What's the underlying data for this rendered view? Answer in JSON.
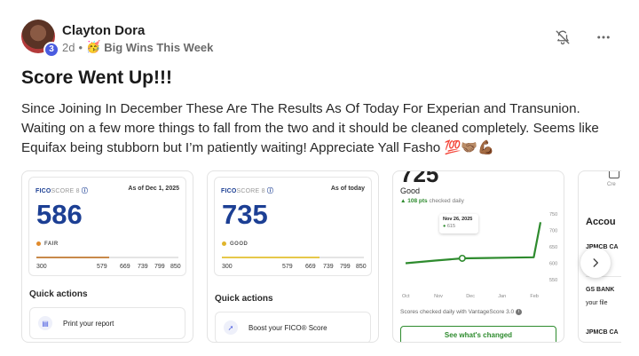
{
  "post": {
    "author": "Clayton Dora",
    "avatar_badge": "3",
    "time": "2d",
    "separator": "•",
    "group_emoji": "🥳",
    "group": "Big Wins This Week",
    "title": "Score Went Up!!!",
    "body": "Since Joining In December These Are The Results As Of Today For Experian and Transunion. Waiting on a few more things to fall from the two and it should be cleaned completely. Seems like Equifax being stubborn but I’m patiently waiting! Appreciate Yall Fasho 💯🤝🏽💪🏾"
  },
  "icons": {
    "notify": "bell-off-icon",
    "more": "more-horizontal-icon",
    "next": "chevron-right-icon"
  },
  "gallery": {
    "card1": {
      "logo_bold": "FICO",
      "logo_light": "SCORE 8",
      "date": "As of Dec 1, 2025",
      "score": "586",
      "rating": "FAIR",
      "rating_color": "#e08a2c",
      "fill_color": "#c8894a",
      "fill_fraction": 0.51,
      "scale": [
        "300",
        "579",
        "669",
        "739",
        "799",
        "850"
      ],
      "quick_title": "Quick actions",
      "action_label": "Print your report"
    },
    "card2": {
      "logo_bold": "FICO",
      "logo_light": "SCORE 8",
      "date": "As of today",
      "score": "735",
      "rating": "GOOD",
      "rating_color": "#e0b52c",
      "fill_color": "#e6c84a",
      "fill_fraction": 0.69,
      "scale": [
        "300",
        "579",
        "669",
        "739",
        "799",
        "850"
      ],
      "quick_title": "Quick actions",
      "action_label": "Boost your FICO® Score"
    },
    "card3": {
      "score": "725",
      "rating": "Good",
      "change": "▲ 108 pts",
      "change_note": "checked daily",
      "tooltip_date": "Nov 26, 2025",
      "tooltip_value": "615",
      "line_color": "#2e8b2e",
      "chart_data": {
        "type": "line",
        "x": [
          "Oct",
          "Nov",
          "Dec",
          "Jan",
          "Feb"
        ],
        "y_ticks": [
          "550",
          "600",
          "650",
          "700",
          "750"
        ],
        "ylim": [
          550,
          750
        ],
        "series": [
          {
            "values": [
              600,
              608,
              615,
              616,
              617,
              618,
              725
            ]
          }
        ]
      },
      "footer": "Scores checked daily with VantageScore 3.0",
      "button": "See what's changed"
    },
    "card4": {
      "top_text": "Cre",
      "heading": "Accou",
      "item1": "JPMCB CA",
      "item2_line1": "GS BANK",
      "item2_line2": "your file",
      "item3": "JPMCB CA"
    }
  }
}
